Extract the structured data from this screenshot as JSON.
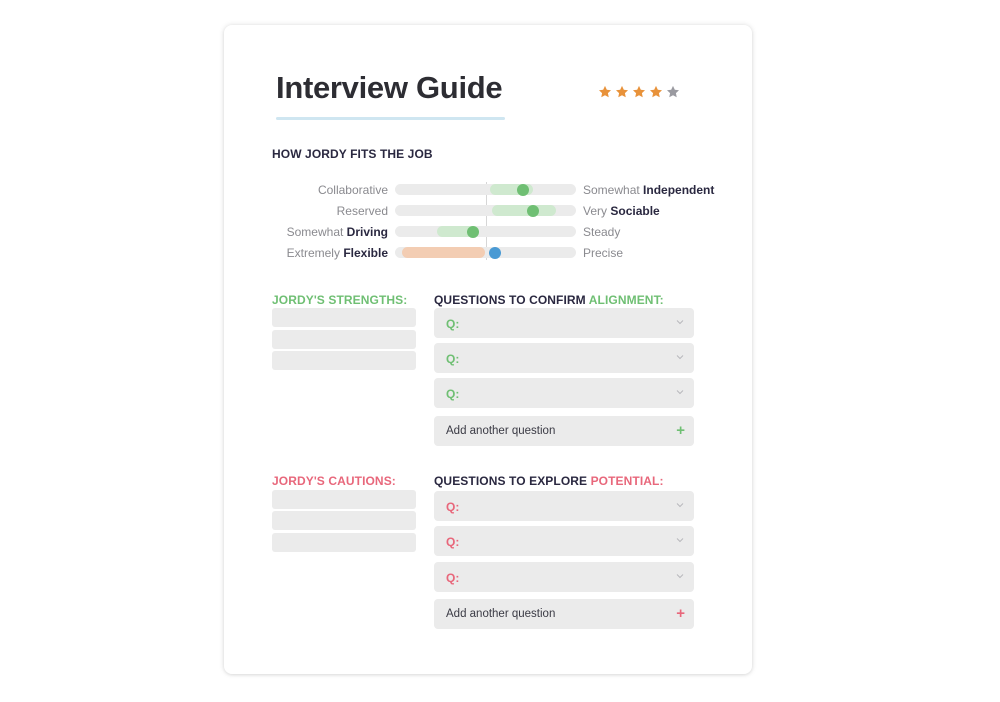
{
  "title": "Interview Guide",
  "rating": {
    "value": 4,
    "max": 5,
    "filled_color": "#E8923A",
    "empty_color": "#9A9AA0"
  },
  "fit_section": {
    "heading": "HOW JORDY FITS THE JOB",
    "scale": {
      "min": -1,
      "max": 1,
      "center": 0
    },
    "traits": [
      {
        "left_prefix": "",
        "left_bold": "",
        "left_plain": "Collaborative",
        "right_prefix": "Somewhat ",
        "right_bold": "Independent",
        "right_plain": "",
        "band": [
          0.05,
          0.52
        ],
        "value": 0.41,
        "band_color": "#cfe9cf",
        "dot_color": "#6fbf73"
      },
      {
        "left_prefix": "",
        "left_bold": "",
        "left_plain": "Reserved",
        "right_prefix": "Very ",
        "right_bold": "Sociable",
        "right_plain": "",
        "band": [
          0.07,
          0.78
        ],
        "value": 0.52,
        "band_color": "#cfe9cf",
        "dot_color": "#6fbf73"
      },
      {
        "left_prefix": "Somewhat ",
        "left_bold": "Driving",
        "left_plain": "",
        "right_prefix": "",
        "right_bold": "",
        "right_plain": "Steady",
        "band": [
          -0.54,
          -0.07
        ],
        "value": -0.14,
        "band_color": "#cfe9cf",
        "dot_color": "#6fbf73"
      },
      {
        "left_prefix": "Extremely ",
        "left_bold": "Flexible",
        "left_plain": "",
        "right_prefix": "",
        "right_bold": "",
        "right_plain": "Precise",
        "band": [
          -0.92,
          -0.01
        ],
        "value": 0.1,
        "band_color": "#f3cdb3",
        "dot_color": "#4a9ad4"
      }
    ]
  },
  "strengths": {
    "heading": "JORDY'S STRENGTHS:",
    "color": "#6fbf73",
    "items": [
      "",
      "",
      ""
    ],
    "questions_heading_prefix": "QUESTIONS TO CONFIRM ",
    "questions_heading_accent": "ALIGNMENT:",
    "questions": [
      {
        "label": "Q:"
      },
      {
        "label": "Q:"
      },
      {
        "label": "Q:"
      }
    ],
    "add_label": "Add another question"
  },
  "cautions": {
    "heading": "JORDY'S CAUTIONS:",
    "color": "#e8677b",
    "items": [
      "",
      "",
      ""
    ],
    "questions_heading_prefix": "QUESTIONS TO EXPLORE ",
    "questions_heading_accent": "POTENTIAL:",
    "questions": [
      {
        "label": "Q:"
      },
      {
        "label": "Q:"
      },
      {
        "label": "Q:"
      }
    ],
    "add_label": "Add another question"
  }
}
